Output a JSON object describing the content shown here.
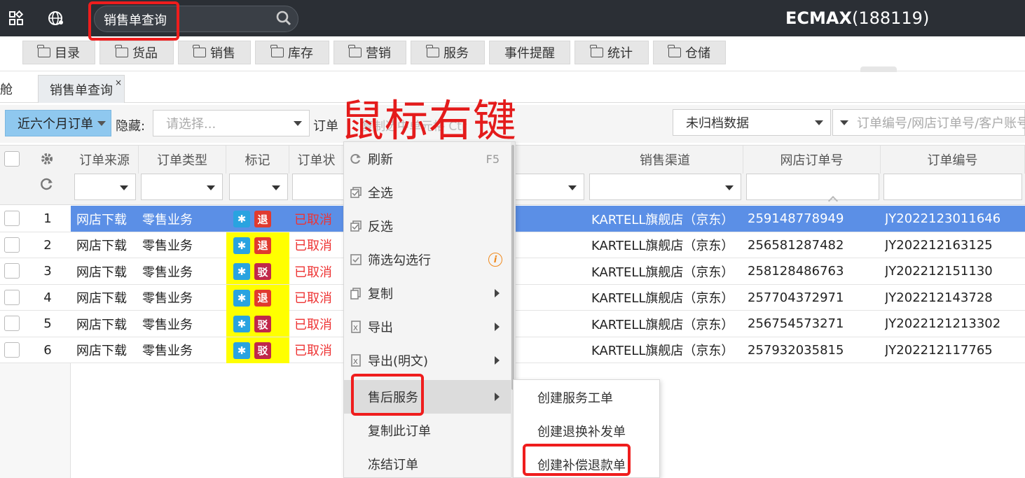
{
  "brand": {
    "name": "ECMAX",
    "account": "(188119)"
  },
  "search": {
    "value": "销售单查询"
  },
  "nav": [
    "目录",
    "货品",
    "销售",
    "库存",
    "营销",
    "服务",
    "事件提醒",
    "统计",
    "仓储"
  ],
  "tabs": {
    "left_partial": "舱",
    "active": "销售单查询",
    "close": "×"
  },
  "filter": {
    "period": "近六个月订单",
    "hide_label": "隐藏:",
    "hide_placeholder": "请选择...",
    "order_label": "订单",
    "hint": "复制选中单元格 Ctr",
    "archive": "未归档数据",
    "search_placeholder": "订单编号/网店订单号/客户账号"
  },
  "columns": {
    "source": "订单来源",
    "type": "订单类型",
    "mark": "标记",
    "status": "订单状",
    "channel": "销售渠道",
    "shop_order": "网店订单号",
    "order_no": "订单编号"
  },
  "rows": [
    {
      "n": "1",
      "source": "网店下载",
      "type": "零售业务",
      "mark": "退",
      "status": "已取消",
      "channel": "KARTELL旗舰店（京东）",
      "shop_order": "259148778949",
      "order_no": "JY2022123011646"
    },
    {
      "n": "2",
      "source": "网店下载",
      "type": "零售业务",
      "mark": "退",
      "status": "已取消",
      "channel": "KARTELL旗舰店（京东）",
      "shop_order": "256581287482",
      "order_no": "JY202212163125"
    },
    {
      "n": "3",
      "source": "网店下载",
      "type": "零售业务",
      "mark": "驳",
      "status": "已取消",
      "channel": "KARTELL旗舰店（京东）",
      "shop_order": "258128486763",
      "order_no": "JY202212151130"
    },
    {
      "n": "4",
      "source": "网店下载",
      "type": "零售业务",
      "mark": "退",
      "status": "已取消",
      "channel": "KARTELL旗舰店（京东）",
      "shop_order": "257704372971",
      "order_no": "JY202212143728"
    },
    {
      "n": "5",
      "source": "网店下载",
      "type": "零售业务",
      "mark": "驳",
      "status": "已取消",
      "channel": "KARTELL旗舰店（京东）",
      "shop_order": "256754573271",
      "order_no": "JY2022121213302"
    },
    {
      "n": "6",
      "source": "网店下载",
      "type": "零售业务",
      "mark": "驳",
      "status": "已取消",
      "channel": "KARTELL旗舰店（京东）",
      "shop_order": "257932035815",
      "order_no": "JY202212117765"
    }
  ],
  "star_glyph": "✱",
  "context_menu": {
    "refresh": "刷新",
    "refresh_key": "F5",
    "select_all": "全选",
    "invert": "反选",
    "filter_checked": "筛选勾选行",
    "copy": "复制",
    "export": "导出",
    "export_plain": "导出(明文)",
    "after_sales": "售后服务",
    "copy_order": "复制此订单",
    "freeze": "冻结订单"
  },
  "submenu": {
    "service_ticket": "创建服务工单",
    "return_exchange": "创建退换补发单",
    "refund": "创建补偿退款单"
  },
  "annotation": "鼠标右键",
  "colors": {
    "topbar": "#2b2f35",
    "selected_row": "#5b8fe6",
    "mark_bg": "#ffff00",
    "annotation": "#e41b1b"
  }
}
